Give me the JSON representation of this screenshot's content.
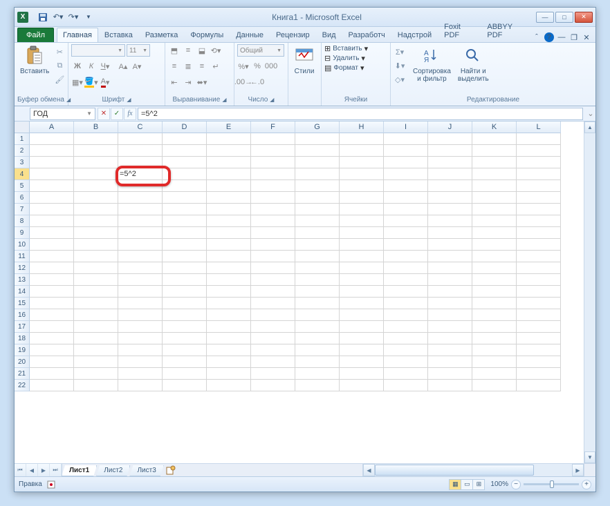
{
  "window": {
    "title": "Книга1  -  Microsoft Excel"
  },
  "qat": {
    "save": "💾",
    "undo": "↶",
    "redo": "↷"
  },
  "tabs": {
    "file": "Файл",
    "items": [
      "Главная",
      "Вставка",
      "Разметка",
      "Формулы",
      "Данные",
      "Рецензир",
      "Вид",
      "Разработч",
      "Надстрой",
      "Foxit PDF",
      "ABBYY PDF"
    ],
    "active_index": 0
  },
  "ribbon": {
    "clipboard": {
      "paste": "Вставить",
      "label": "Буфер обмена"
    },
    "font": {
      "name": "",
      "size": "11",
      "label": "Шрифт"
    },
    "alignment": {
      "label": "Выравнивание"
    },
    "number": {
      "format": "Общий",
      "label": "Число"
    },
    "styles": {
      "btn": "Стили",
      "label": ""
    },
    "cells": {
      "insert": "Вставить",
      "delete": "Удалить",
      "format": "Формат",
      "label": "Ячейки"
    },
    "editing": {
      "sort": "Сортировка\nи фильтр",
      "find": "Найти и\nвыделить",
      "label": "Редактирование"
    }
  },
  "formula_bar": {
    "name_box": "ГОД",
    "formula": "=5^2"
  },
  "grid": {
    "columns": [
      "A",
      "B",
      "C",
      "D",
      "E",
      "F",
      "G",
      "H",
      "I",
      "J",
      "K",
      "L"
    ],
    "rows": 22,
    "active_cell": {
      "row": 4,
      "col": "C",
      "value": "=5^2"
    }
  },
  "sheets": {
    "items": [
      "Лист1",
      "Лист2",
      "Лист3"
    ],
    "active_index": 0
  },
  "status": {
    "mode": "Правка",
    "zoom": "100%"
  }
}
